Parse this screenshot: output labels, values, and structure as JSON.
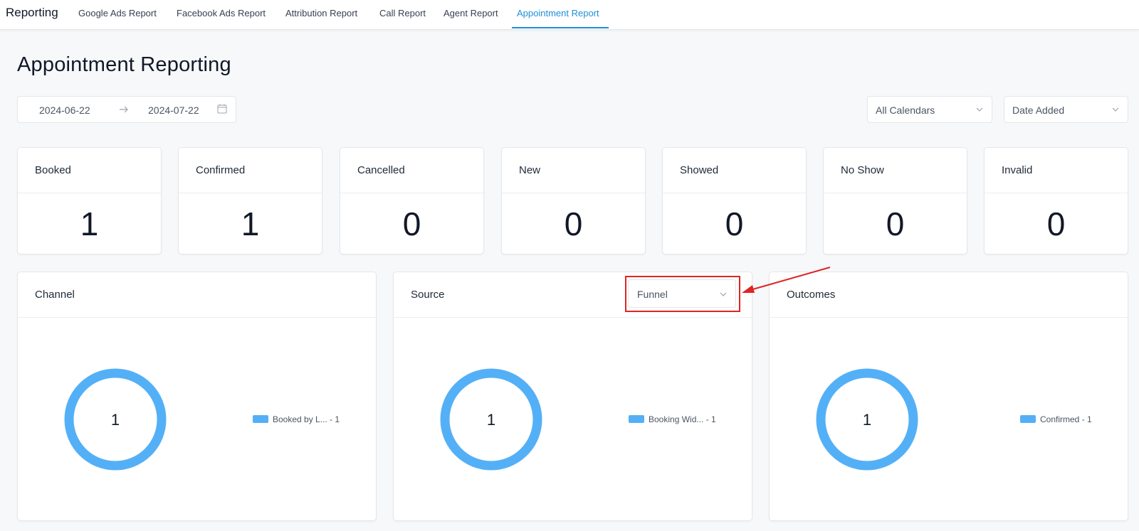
{
  "nav": {
    "brand": "Reporting",
    "tabs": [
      {
        "label": "Google Ads Report"
      },
      {
        "label": "Facebook Ads Report"
      },
      {
        "label": "Attribution Report"
      },
      {
        "label": "Call Report"
      },
      {
        "label": "Agent Report"
      },
      {
        "label": "Appointment Report",
        "active": true
      }
    ]
  },
  "page": {
    "title": "Appointment Reporting"
  },
  "filters": {
    "start_date": "2024-06-22",
    "end_date": "2024-07-22",
    "calendar_select": "All Calendars",
    "date_type_select": "Date Added"
  },
  "stats": [
    {
      "label": "Booked",
      "value": "1"
    },
    {
      "label": "Confirmed",
      "value": "1"
    },
    {
      "label": "Cancelled",
      "value": "0"
    },
    {
      "label": "New",
      "value": "0"
    },
    {
      "label": "Showed",
      "value": "0"
    },
    {
      "label": "No Show",
      "value": "0"
    },
    {
      "label": "Invalid",
      "value": "0"
    }
  ],
  "panels": [
    {
      "title": "Channel",
      "total": "1",
      "legend": "Booked by L... - 1"
    },
    {
      "title": "Source",
      "total": "1",
      "legend": "Booking Wid... - 1",
      "select": "Funnel"
    },
    {
      "title": "Outcomes",
      "total": "1",
      "legend": "Confirmed - 1"
    }
  ],
  "colors": {
    "accent": "#1e90d6",
    "donut": "#54b0f6",
    "annotation": "#e02424"
  }
}
